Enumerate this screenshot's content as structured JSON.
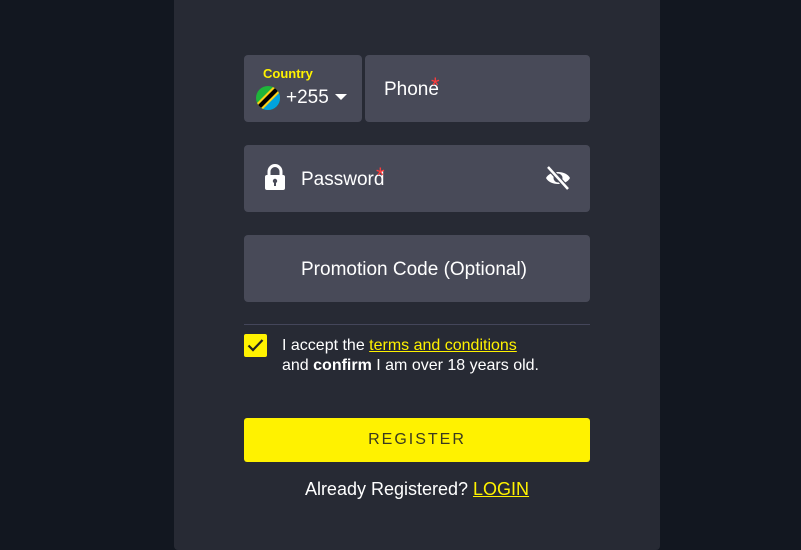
{
  "form": {
    "country": {
      "label": "Country",
      "dial_code": "+255",
      "flag_icon": "tanzania-flag-icon"
    },
    "phone": {
      "label": "Phone",
      "required_mark": "*"
    },
    "password": {
      "label": "Password",
      "required_mark": "*",
      "lock_icon": "lock-icon",
      "visibility_icon": "eye-slash-icon"
    },
    "promo": {
      "label": "Promotion Code (Optional)"
    },
    "terms": {
      "checked": true,
      "text_before": "I accept the ",
      "link_text": "terms and conditions",
      "line2_prefix": "and ",
      "line2_bold": "confirm",
      "line2_suffix": " I am over 18 years old."
    },
    "register_label": "REGISTER",
    "already_text": "Already Registered? ",
    "login_label": "LOGIN"
  },
  "colors": {
    "background": "#121720",
    "panel": "#272a34",
    "field": "#484a58",
    "accent": "#fff200",
    "required": "#ff3b3b"
  }
}
